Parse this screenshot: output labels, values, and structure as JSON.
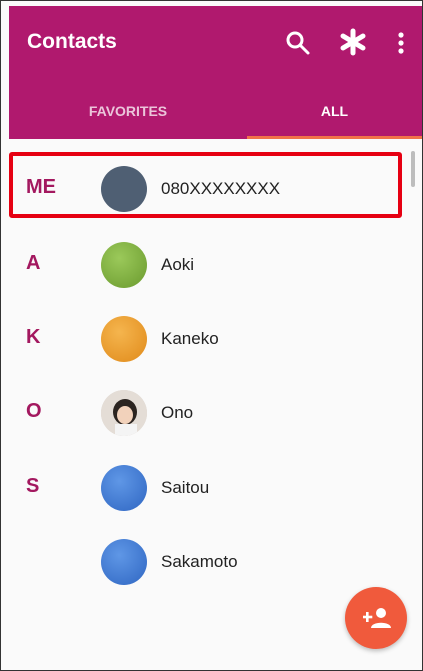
{
  "app": {
    "title": "Contacts"
  },
  "toolbar": {
    "icons": [
      "search-icon",
      "asterisk-icon",
      "more-vertical-icon"
    ]
  },
  "tabs": [
    {
      "label": "FAVORITES",
      "selected": false
    },
    {
      "label": "ALL",
      "selected": true
    }
  ],
  "contacts": [
    {
      "letter": "ME",
      "name": "080XXXXXXXX",
      "avatar_color": "#4f5f73",
      "highlighted": true
    },
    {
      "letter": "A",
      "name": "Aoki",
      "avatar_color": "#7cab3b"
    },
    {
      "letter": "K",
      "name": "Kaneko",
      "avatar_color": "#ec9a2c"
    },
    {
      "letter": "O",
      "name": "Ono",
      "avatar_color": "photo"
    },
    {
      "letter": "S",
      "name": "Saitou",
      "avatar_color": "#3f7bd4"
    },
    {
      "letter": "",
      "name": "Sakamoto",
      "avatar_color": "#3f7bd4"
    }
  ],
  "fab": {
    "icon": "add-contact-icon"
  },
  "colors": {
    "app_bar": "#b0196e",
    "accent": "#f0734a",
    "letter": "#a3185f",
    "highlight_box": "#e60012",
    "fab": "#f05a3c"
  }
}
